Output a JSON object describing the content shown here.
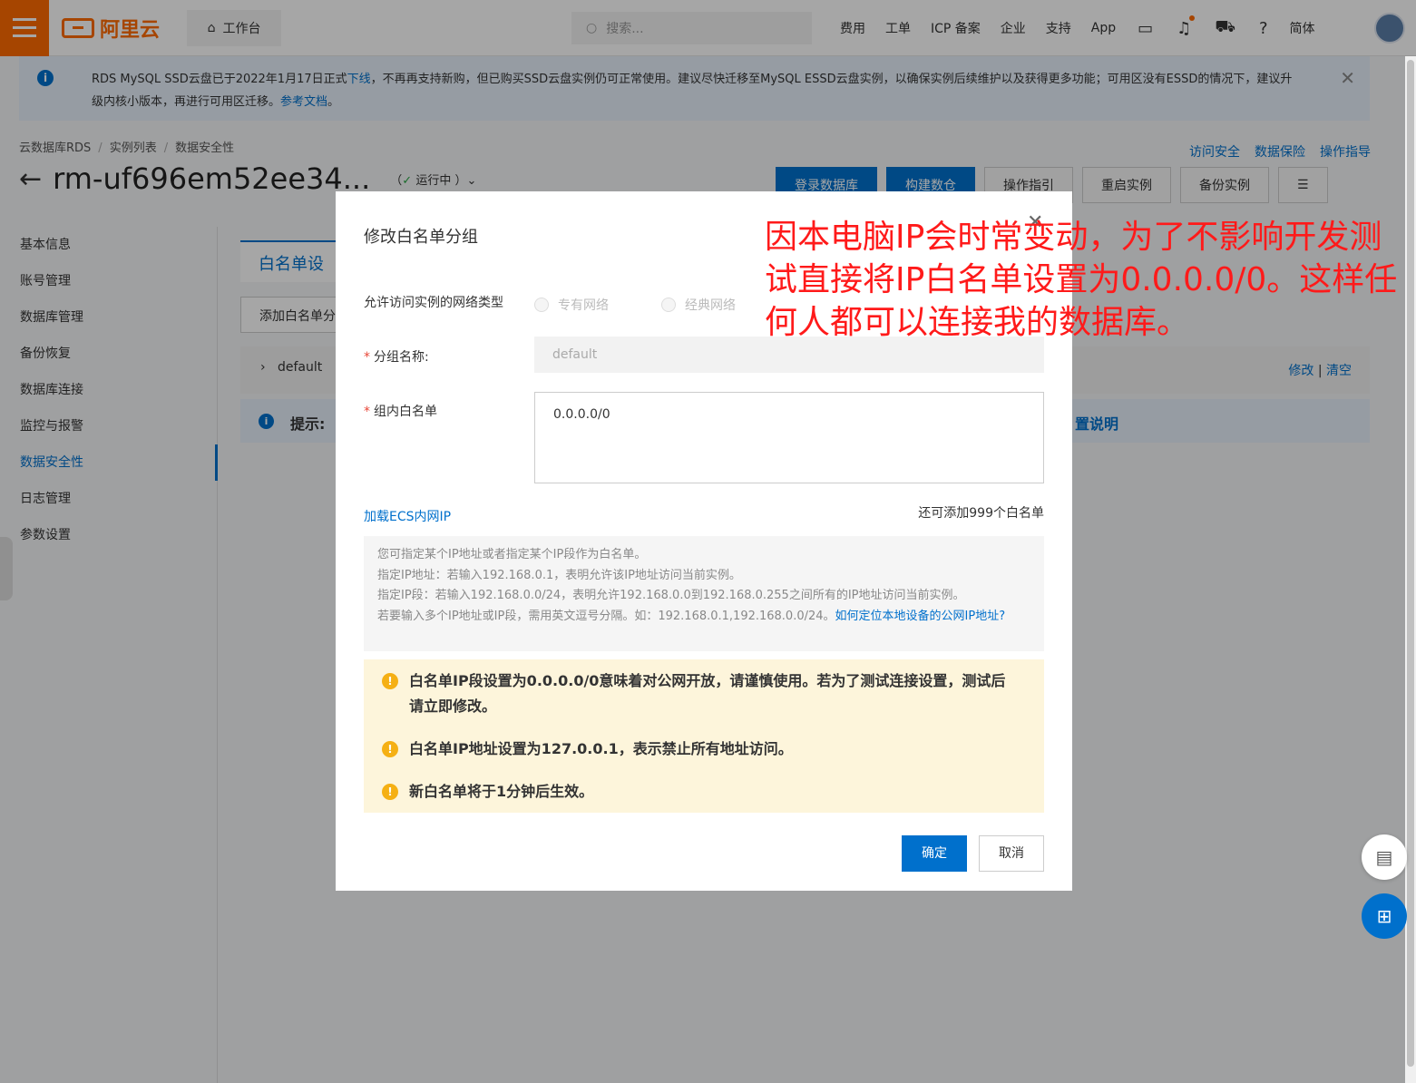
{
  "topbar": {
    "logo_text": "阿里云",
    "workbench": "工作台",
    "search_placeholder": "搜索...",
    "links": [
      "费用",
      "工单",
      "ICP 备案",
      "企业",
      "支持",
      "App"
    ],
    "lang": "简体"
  },
  "notice": {
    "text_a": "RDS MySQL SSD云盘已于2022年1月17日正式",
    "link_a": "下线",
    "text_b": "，不再再支持新购，但已购买SSD云盘实例仍可正常使用。建议尽快迁移至MySQL ESSD云盘实例，以确保实例后续维护以及获得更多功能；可用区没有ESSD的情况下，建议升级内核小版本，再进行可用区迁移。",
    "link_b": "参考文档",
    "text_c": "。"
  },
  "breadcrumb": [
    "云数据库RDS",
    "实例列表",
    "数据安全性"
  ],
  "page": {
    "instance_id": "rm-uf696em52ee34...",
    "status": "运行中"
  },
  "help_links": [
    "访问安全",
    "数据保险",
    "操作指导"
  ],
  "actions": [
    "登录数据库",
    "构建数仓",
    "操作指引",
    "重启实例",
    "备份实例"
  ],
  "sidebar": {
    "items": [
      {
        "label": "基本信息"
      },
      {
        "label": "账号管理"
      },
      {
        "label": "数据库管理"
      },
      {
        "label": "备份恢复"
      },
      {
        "label": "数据库连接"
      },
      {
        "label": "监控与报警"
      },
      {
        "label": "数据安全性"
      },
      {
        "label": "日志管理"
      },
      {
        "label": "参数设置"
      }
    ]
  },
  "main": {
    "tab": "白名单设",
    "add_group": "添加白名单分",
    "group_name": "default",
    "edit": "修改",
    "clear": "清空",
    "tip_label": "提示:",
    "tip_right": "置说明"
  },
  "modal": {
    "title": "修改白名单分组",
    "network_label": "允许访问实例的网络类型",
    "radio_vpc": "专有网络",
    "radio_classic": "经典网络",
    "group_name_label": "分组名称:",
    "group_name_value": "default",
    "whitelist_label": "组内白名单",
    "whitelist_value": "0.0.0.0/0",
    "load_ecs": "加载ECS内网IP",
    "remaining": "还可添加999个白名单",
    "hint_1": "您可指定某个IP地址或者指定某个IP段作为白名单。",
    "hint_2": "指定IP地址：若输入192.168.0.1，表明允许该IP地址访问当前实例。",
    "hint_3": "指定IP段：若输入192.168.0.0/24，表明允许192.168.0.0到192.168.0.255之间所有的IP地址访问当前实例。",
    "hint_4": "若要输入多个IP地址或IP段，需用英文逗号分隔。如：192.168.0.1,192.168.0.0/24。",
    "hint_link": "如何定位本地设备的公网IP地址?",
    "warn_1": "白名单IP段设置为0.0.0.0/0意味着对公网开放，请谨慎使用。若为了测试连接设置，测试后请立即修改。",
    "warn_2": "白名单IP地址设置为127.0.0.1，表示禁止所有地址访问。",
    "warn_3": "新白名单将于1分钟后生效。",
    "ok": "确定",
    "cancel": "取消"
  },
  "annotation": "因本电脑IP会时常变动，为了不影响开发测试直接将IP白名单设置为0.0.0.0/0。这样任何人都可以连接我的数据库。"
}
